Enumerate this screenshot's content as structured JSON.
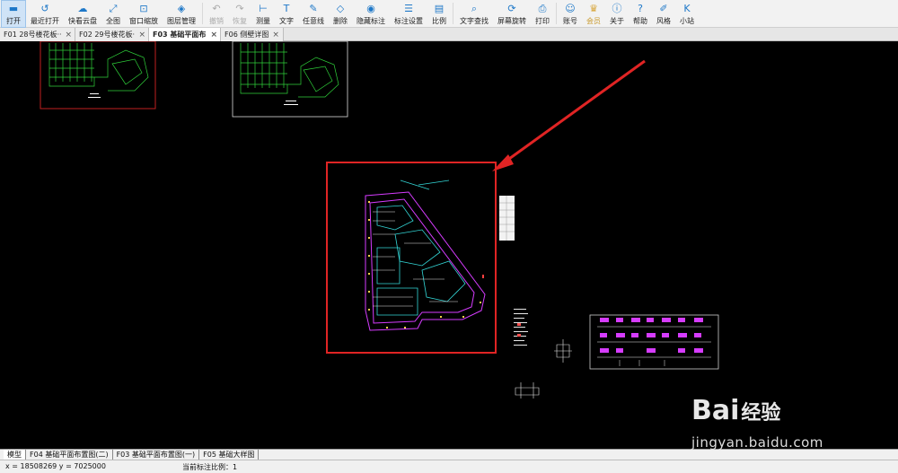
{
  "toolbar": {
    "items": [
      {
        "label": "打开",
        "icon": "folder-open-icon",
        "glyph": "▬",
        "active": true
      },
      {
        "label": "最近打开",
        "icon": "history-icon",
        "glyph": "↺"
      },
      {
        "label": "快看云盘",
        "icon": "cloud-icon",
        "glyph": "☁"
      },
      {
        "label": "全图",
        "icon": "fit-view-icon",
        "glyph": "⤢"
      },
      {
        "label": "窗口缩放",
        "icon": "window-zoom-icon",
        "glyph": "⊡"
      },
      {
        "label": "图层管理",
        "icon": "layers-icon",
        "glyph": "◈"
      },
      {
        "label": "撤销",
        "icon": "undo-icon",
        "glyph": "↶",
        "disabled": true
      },
      {
        "label": "恢复",
        "icon": "redo-icon",
        "glyph": "↷",
        "disabled": true
      },
      {
        "label": "测量",
        "icon": "measure-icon",
        "glyph": "⊢"
      },
      {
        "label": "文字",
        "icon": "text-icon",
        "glyph": "T"
      },
      {
        "label": "任意线",
        "icon": "pencil-icon",
        "glyph": "✎"
      },
      {
        "label": "删除",
        "icon": "eraser-icon",
        "glyph": "◇"
      },
      {
        "label": "隐藏标注",
        "icon": "eye-hide-icon",
        "glyph": "◉"
      },
      {
        "label": "标注设置",
        "icon": "annotation-settings-icon",
        "glyph": "☰"
      },
      {
        "label": "比例",
        "icon": "scale-icon",
        "glyph": "▤"
      },
      {
        "label": "文字查找",
        "icon": "text-search-icon",
        "glyph": "⌕"
      },
      {
        "label": "屏幕旋转",
        "icon": "screen-rotate-icon",
        "glyph": "⟳"
      },
      {
        "label": "打印",
        "icon": "print-icon",
        "glyph": "⎙"
      },
      {
        "label": "账号",
        "icon": "user-icon",
        "glyph": "☺"
      },
      {
        "label": "会员",
        "icon": "vip-icon",
        "glyph": "♛",
        "vip": true
      },
      {
        "label": "关于",
        "icon": "info-icon",
        "glyph": "ⓘ"
      },
      {
        "label": "帮助",
        "icon": "help-icon",
        "glyph": "?"
      },
      {
        "label": "风格",
        "icon": "style-icon",
        "glyph": "✐"
      },
      {
        "label": "小站",
        "icon": "kuaikan-icon",
        "glyph": "K"
      }
    ]
  },
  "tabs": [
    {
      "label": "F01  28号楼花板···",
      "active": false
    },
    {
      "label": "F02  29号楼花板···",
      "active": false
    },
    {
      "label": "F03  基础平面布··",
      "active": true
    },
    {
      "label": "F06  侧壁详图",
      "active": false
    }
  ],
  "sheet_tabs": [
    {
      "label": "模型",
      "active": true
    },
    {
      "label": "F04 基础平面布置图(二)",
      "active": false
    },
    {
      "label": "F03 基础平面布置图(一)",
      "active": false
    },
    {
      "label": "F05 基础大样图",
      "active": false
    }
  ],
  "status": {
    "coordinates": "x = 18508269  y = 7025000",
    "scale": "当前标注比例：1"
  },
  "watermark": {
    "logo": "Bai",
    "logo_cn": "经验",
    "url": "jingyan.baidu.com"
  },
  "colors": {
    "canvas_bg": "#000000",
    "highlight_red": "#e02424",
    "drawing_green": "#2fd13a",
    "drawing_magenta": "#d63cff",
    "drawing_cyan": "#33d6d6"
  }
}
